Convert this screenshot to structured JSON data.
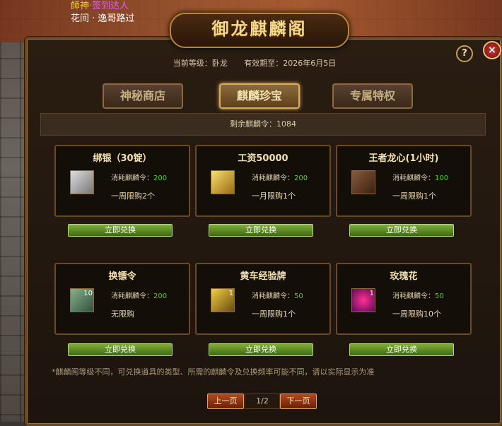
{
  "chat": {
    "line1_name": "師神",
    "line1_tag": "·签到达人",
    "line2": "花间 · 逸哥路过"
  },
  "window": {
    "title": "御龙麒麟阁",
    "help_label": "?",
    "close_label": "×"
  },
  "info": {
    "level": "当前等级：卧龙",
    "expiry": "有效期至：2026年6月5日"
  },
  "tabs": [
    {
      "label": "神秘商店",
      "active": false
    },
    {
      "label": "麒麟珍宝",
      "active": true
    },
    {
      "label": "专属特权",
      "active": false
    }
  ],
  "remaining": "剩余麒麟令：1084",
  "items": [
    {
      "name": "绑银（30锭）",
      "cost_label": "消耗麒麟令：",
      "cost": "200",
      "limit": "一周限购2个",
      "qty": "",
      "icon": "silver-ingot-icon",
      "button": "立即兑换"
    },
    {
      "name": "工资50000",
      "cost_label": "消耗麒麟令：",
      "cost": "200",
      "limit": "一月限购1个",
      "qty": "",
      "icon": "salary-icon",
      "button": "立即兑换"
    },
    {
      "name": "王者龙心(1小时)",
      "cost_label": "消耗麒麟令：",
      "cost": "100",
      "limit": "一周限购1个",
      "qty": "",
      "icon": "dragon-heart-icon",
      "button": "立即兑换"
    },
    {
      "name": "换镖令",
      "cost_label": "消耗麒麟令：",
      "cost": "200",
      "limit": "无限购",
      "qty": "10",
      "icon": "escort-token-icon",
      "button": "立即兑换"
    },
    {
      "name": "黄车经验牌",
      "cost_label": "消耗麒麟令：",
      "cost": "50",
      "limit": "一周限购1个",
      "qty": "1",
      "icon": "exp-plate-icon",
      "button": "立即兑换"
    },
    {
      "name": "玫瑰花",
      "cost_label": "消耗麒麟令：",
      "cost": "50",
      "limit": "一周限购10个",
      "qty": "1",
      "icon": "rose-icon",
      "button": "立即兑换"
    }
  ],
  "note": "*麒麟阁等级不同，可兑换道具的类型、所需的麒麟令及兑换频率可能不同，请以实际显示为准",
  "pager": {
    "prev": "上一页",
    "page": "1/2",
    "next": "下一页"
  },
  "colors": {
    "accent": "#f3e2b0",
    "cost_value": "#55cc30",
    "button": "#5a8a24"
  }
}
